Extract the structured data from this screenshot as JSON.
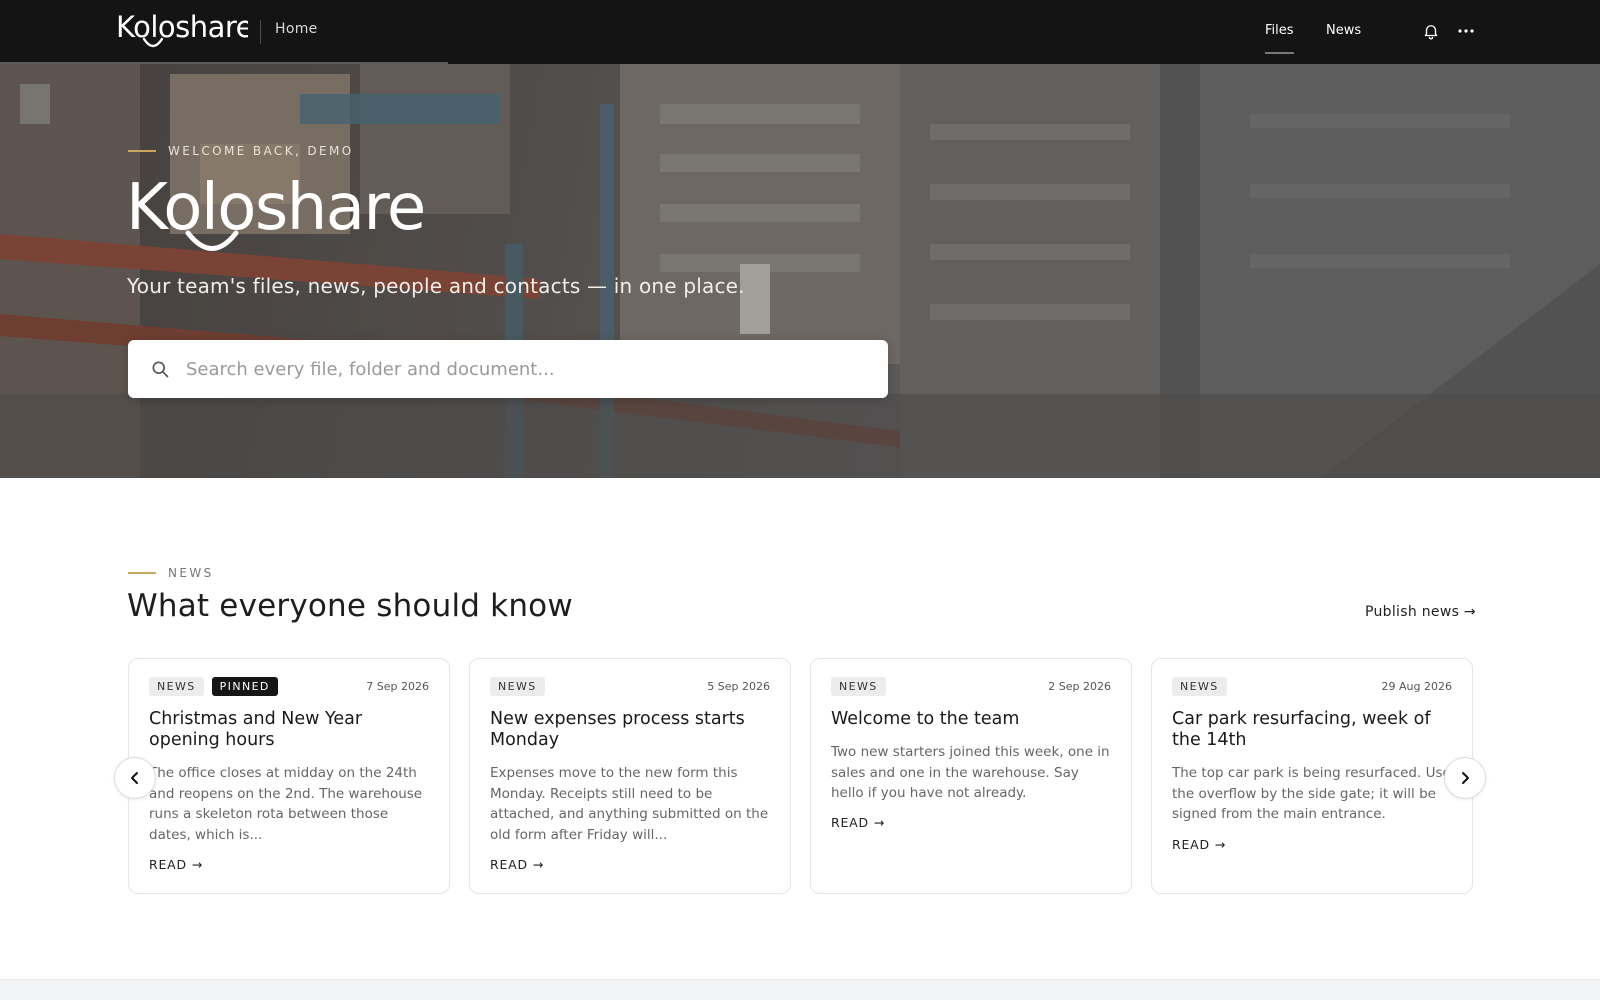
{
  "topbar": {
    "brand": "Koloshare",
    "home_label": "Home",
    "nav": [
      {
        "label": "Files",
        "active": true
      },
      {
        "label": "News",
        "active": false
      }
    ],
    "icons": [
      "bell-icon",
      "more-icon"
    ]
  },
  "hero": {
    "eyebrow": "WELCOME BACK, DEMO",
    "logo": "Koloshare",
    "tagline": "Your team's files, news, people and contacts — in one place.",
    "search_placeholder": "Search every file, folder and document...",
    "search_value": ""
  },
  "news": {
    "eyebrow": "NEWS",
    "title": "What everyone should know",
    "publish_label": "Publish news →",
    "cards": [
      {
        "tags": [
          "NEWS",
          "PINNED"
        ],
        "date": "7 Sep 2026",
        "title": "Christmas and New Year opening hours",
        "excerpt": "The office closes at midday on the 24th and reopens on the 2nd. The warehouse runs a skeleton rota between those dates, which is...",
        "read_label": "READ →"
      },
      {
        "tags": [
          "NEWS"
        ],
        "date": "5 Sep 2026",
        "title": "New expenses process starts Monday",
        "excerpt": "Expenses move to the new form this Monday. Receipts still need to be attached, and anything submitted on the old form after Friday will...",
        "read_label": "READ →"
      },
      {
        "tags": [
          "NEWS"
        ],
        "date": "2 Sep 2026",
        "title": "Welcome to the team",
        "excerpt": "Two new starters joined this week, one in sales and one in the warehouse. Say hello if you have not already.",
        "read_label": "READ →"
      },
      {
        "tags": [
          "NEWS"
        ],
        "date": "29 Aug 2026",
        "title": "Car park resurfacing, week of the 14th",
        "excerpt": "The top car park is being resurfaced. Use the overflow by the side gate; it will be signed from the main entrance.",
        "read_label": "READ →"
      }
    ],
    "carousel_icons": [
      "chevron-left-icon",
      "chevron-right-icon"
    ]
  },
  "colors": {
    "topbar_bg": "#141414",
    "accent_rule": "#c9a85c",
    "pinned_tag_bg": "#161616",
    "tag_bg": "#ececec"
  }
}
